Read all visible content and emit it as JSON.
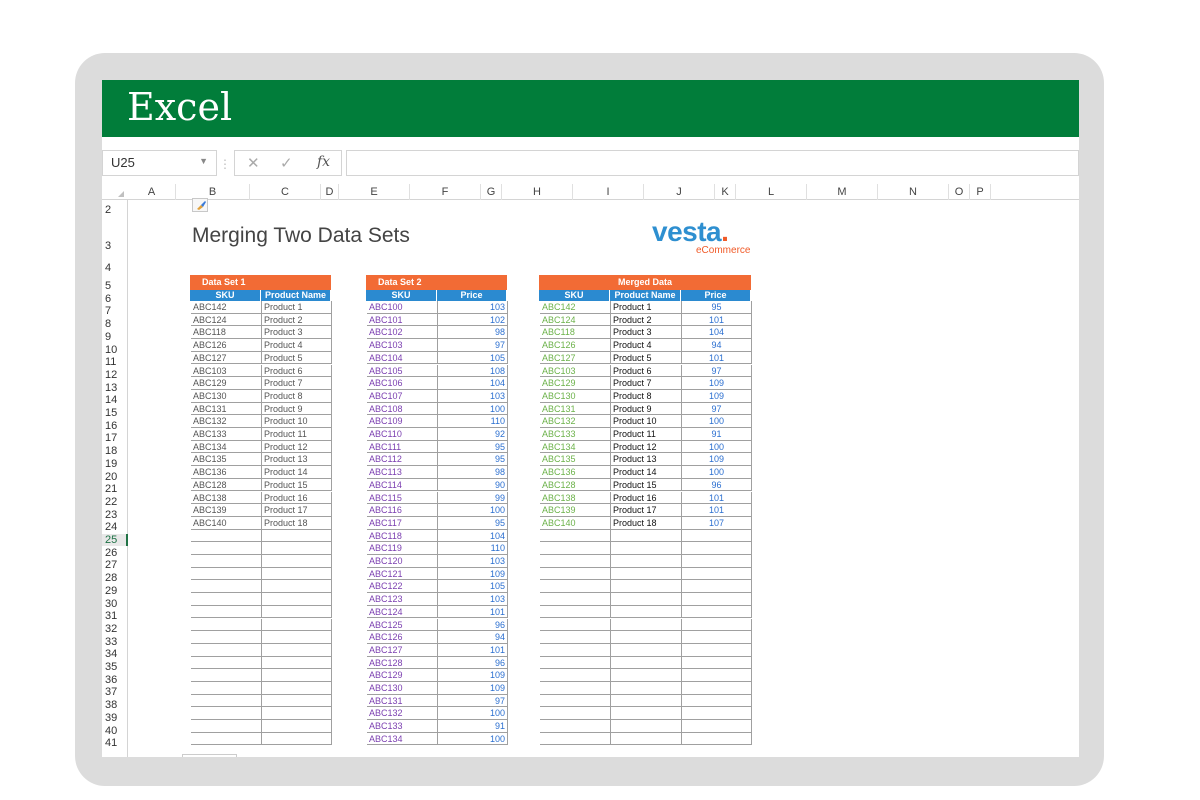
{
  "app": {
    "title": "Excel"
  },
  "formula_bar": {
    "name_box": "U25",
    "fx_label": "fx",
    "cancel_icon": "close-icon",
    "enter_icon": "check-icon"
  },
  "columns": [
    "A",
    "B",
    "C",
    "D",
    "E",
    "F",
    "G",
    "H",
    "I",
    "J",
    "K",
    "L",
    "M",
    "N",
    "O",
    "P"
  ],
  "rows": [
    "2",
    "3",
    "4",
    "5",
    "6",
    "7",
    "8",
    "9",
    "10",
    "11",
    "12",
    "13",
    "14",
    "15",
    "16",
    "17",
    "18",
    "19",
    "20",
    "21",
    "22",
    "23",
    "24",
    "25",
    "26",
    "27",
    "28",
    "29",
    "30",
    "31",
    "32",
    "33",
    "34",
    "35",
    "36",
    "37",
    "38",
    "39",
    "40",
    "41"
  ],
  "selected_row": "25",
  "sheet": {
    "title": "Merging Two Data Sets",
    "logo_text": "vesta",
    "logo_dot": ".",
    "logo_sub": "eCommerce"
  },
  "dataset1": {
    "title": "Data Set 1",
    "headers": [
      "SKU",
      "Product Name"
    ],
    "rows": [
      [
        "ABC142",
        "Product 1"
      ],
      [
        "ABC124",
        "Product 2"
      ],
      [
        "ABC118",
        "Product 3"
      ],
      [
        "ABC126",
        "Product 4"
      ],
      [
        "ABC127",
        "Product 5"
      ],
      [
        "ABC103",
        "Product 6"
      ],
      [
        "ABC129",
        "Product 7"
      ],
      [
        "ABC130",
        "Product 8"
      ],
      [
        "ABC131",
        "Product 9"
      ],
      [
        "ABC132",
        "Product 10"
      ],
      [
        "ABC133",
        "Product 11"
      ],
      [
        "ABC134",
        "Product 12"
      ],
      [
        "ABC135",
        "Product 13"
      ],
      [
        "ABC136",
        "Product 14"
      ],
      [
        "ABC128",
        "Product 15"
      ],
      [
        "ABC138",
        "Product 16"
      ],
      [
        "ABC139",
        "Product 17"
      ],
      [
        "ABC140",
        "Product 18"
      ]
    ]
  },
  "dataset2": {
    "title": "Data Set 2",
    "headers": [
      "SKU",
      "Price"
    ],
    "rows": [
      [
        "ABC100",
        "103"
      ],
      [
        "ABC101",
        "102"
      ],
      [
        "ABC102",
        "98"
      ],
      [
        "ABC103",
        "97"
      ],
      [
        "ABC104",
        "105"
      ],
      [
        "ABC105",
        "108"
      ],
      [
        "ABC106",
        "104"
      ],
      [
        "ABC107",
        "103"
      ],
      [
        "ABC108",
        "100"
      ],
      [
        "ABC109",
        "110"
      ],
      [
        "ABC110",
        "92"
      ],
      [
        "ABC111",
        "95"
      ],
      [
        "ABC112",
        "95"
      ],
      [
        "ABC113",
        "98"
      ],
      [
        "ABC114",
        "90"
      ],
      [
        "ABC115",
        "99"
      ],
      [
        "ABC116",
        "100"
      ],
      [
        "ABC117",
        "95"
      ],
      [
        "ABC118",
        "104"
      ],
      [
        "ABC119",
        "110"
      ],
      [
        "ABC120",
        "103"
      ],
      [
        "ABC121",
        "109"
      ],
      [
        "ABC122",
        "105"
      ],
      [
        "ABC123",
        "103"
      ],
      [
        "ABC124",
        "101"
      ],
      [
        "ABC125",
        "96"
      ],
      [
        "ABC126",
        "94"
      ],
      [
        "ABC127",
        "101"
      ],
      [
        "ABC128",
        "96"
      ],
      [
        "ABC129",
        "109"
      ],
      [
        "ABC130",
        "109"
      ],
      [
        "ABC131",
        "97"
      ],
      [
        "ABC132",
        "100"
      ],
      [
        "ABC133",
        "91"
      ],
      [
        "ABC134",
        "100"
      ]
    ]
  },
  "merged": {
    "title": "Merged Data",
    "headers": [
      "SKU",
      "Product Name",
      "Price"
    ],
    "rows": [
      [
        "ABC142",
        "Product 1",
        "95"
      ],
      [
        "ABC124",
        "Product 2",
        "101"
      ],
      [
        "ABC118",
        "Product 3",
        "104"
      ],
      [
        "ABC126",
        "Product 4",
        "94"
      ],
      [
        "ABC127",
        "Product 5",
        "101"
      ],
      [
        "ABC103",
        "Product 6",
        "97"
      ],
      [
        "ABC129",
        "Product 7",
        "109"
      ],
      [
        "ABC130",
        "Product 8",
        "109"
      ],
      [
        "ABC131",
        "Product 9",
        "97"
      ],
      [
        "ABC132",
        "Product 10",
        "100"
      ],
      [
        "ABC133",
        "Product 11",
        "91"
      ],
      [
        "ABC134",
        "Product 12",
        "100"
      ],
      [
        "ABC135",
        "Product 13",
        "109"
      ],
      [
        "ABC136",
        "Product 14",
        "100"
      ],
      [
        "ABC128",
        "Product 15",
        "96"
      ],
      [
        "ABC138",
        "Product 16",
        "101"
      ],
      [
        "ABC139",
        "Product 17",
        "101"
      ],
      [
        "ABC140",
        "Product 18",
        "107"
      ]
    ]
  },
  "colors": {
    "title_bar": "#017d3a",
    "table_title": "#f26b35",
    "table_header": "#2b8ad0"
  }
}
